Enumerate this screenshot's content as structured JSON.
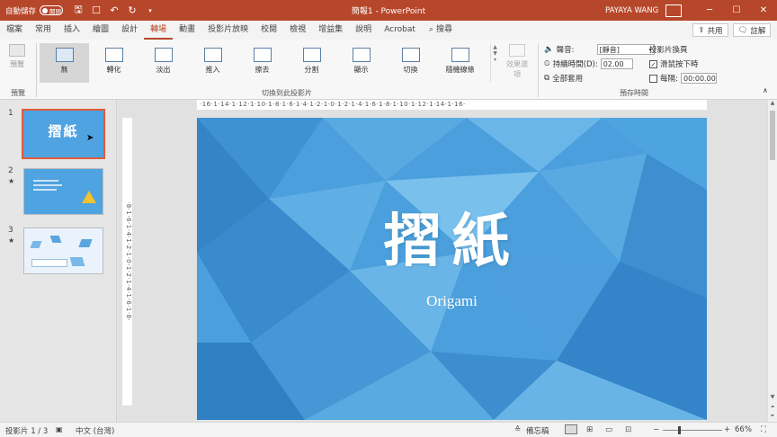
{
  "titlebar": {
    "autosave_label": "自動儲存",
    "autosave_state": "關閉",
    "title": "簡報1 - PowerPoint",
    "user": "PAYAYA WANG"
  },
  "tabs": [
    "檔案",
    "常用",
    "插入",
    "繪圖",
    "設計",
    "轉場",
    "動畫",
    "投影片放映",
    "校閱",
    "檢視",
    "增益集",
    "說明",
    "Acrobat"
  ],
  "active_tab": "轉場",
  "search_label": "搜尋",
  "share_label": "共用",
  "comment_label": "註解",
  "ribbon": {
    "preview_label": "預覽",
    "preview_group": "預覽",
    "transitions": [
      "無",
      "轉化",
      "淡出",
      "推入",
      "擦去",
      "分割",
      "顯示",
      "切換",
      "隨機線條"
    ],
    "selected_transition": "無",
    "effect_options_label": "效果選項",
    "transitions_group": "切換到此投影片",
    "sound_label": "聲音:",
    "sound_value": "[靜音]",
    "duration_label": "持續時間(D):",
    "duration_value": "02.00",
    "apply_all_label": "全部套用",
    "advance_label": "投影片換頁",
    "on_click_label": "滑鼠按下時",
    "on_click_checked": true,
    "after_label": "每隔:",
    "after_value": "00:00.00",
    "after_checked": false,
    "timing_group": "預存時間"
  },
  "slides": [
    {
      "number": "1",
      "title": "摺紙"
    },
    {
      "number": "2",
      "star": "★"
    },
    {
      "number": "3",
      "star": "★"
    }
  ],
  "ruler_h": "·16·1·14·1·12·1·10·1·8·1·6·1·4·1·2·1·0·1·2·1·4·1·6·1·8·1·10·1·12·1·14·1·16·",
  "ruler_v": "·8·1·6·1·4·1·2·1·0·1·2·1·4·1·6·1·8·",
  "slide": {
    "title": "摺紙",
    "subtitle": "Origami"
  },
  "statusbar": {
    "slide_counter": "投影片 1 / 3",
    "language": "中文 (台灣)",
    "notes_label": "備忘稿",
    "zoom_level": "66%"
  },
  "colors": {
    "brand": "#b7472a",
    "slide_blue": "#4fa3e0"
  }
}
